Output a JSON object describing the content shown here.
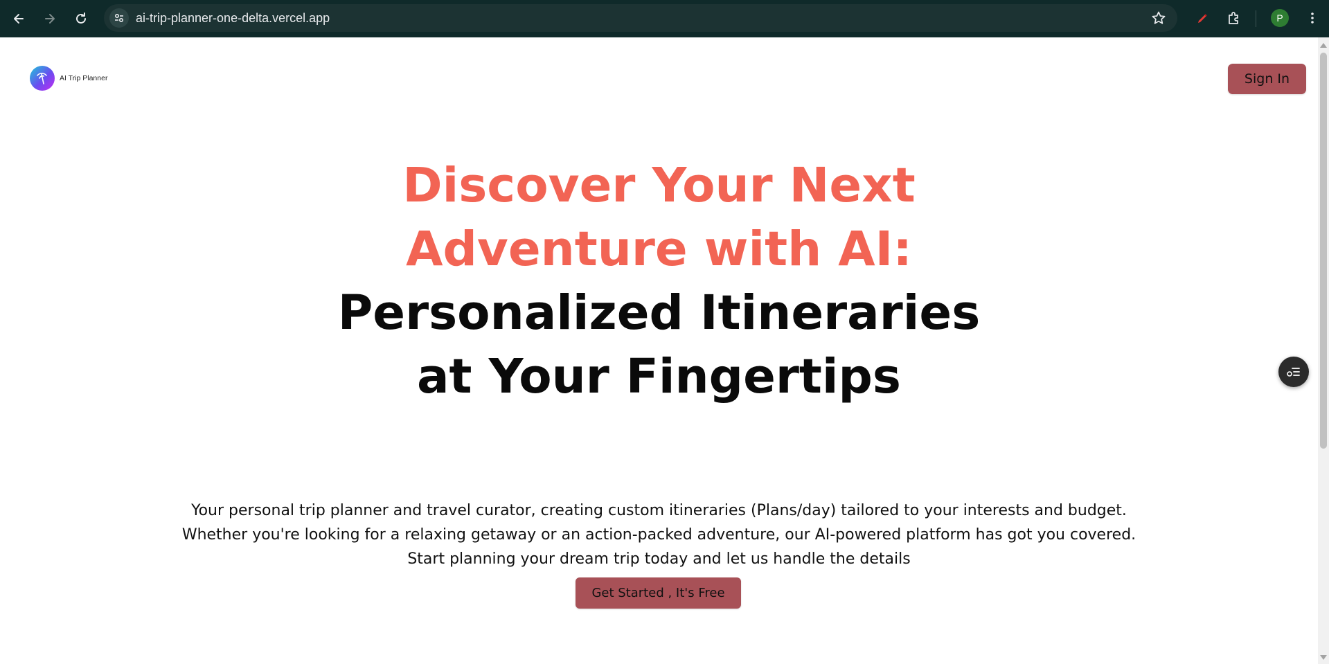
{
  "browser": {
    "url": "ai-trip-planner-one-delta.vercel.app",
    "profile_initial": "P"
  },
  "header": {
    "brand": "AI Trip Planner",
    "signin_label": "Sign In"
  },
  "hero": {
    "line1": "Discover Your Next",
    "line2": "Adventure with AI:",
    "line3": "Personalized Itineraries",
    "line4": "at Your Fingertips",
    "accent_color": "#f26454",
    "dark_color": "#0a0a0a"
  },
  "description": {
    "line1": "Your personal trip planner and travel curator, creating custom itineraries (Plans/day) tailored to your interests and budget.",
    "line2": "Whether you're looking for a relaxing getaway or an action-packed adventure, our AI-powered platform has got you covered.",
    "line3": "Start planning your dream trip today and let us handle the details"
  },
  "cta": {
    "label": "Get Started , It's Free"
  },
  "colors": {
    "button_bg": "#a85157",
    "chrome_bg": "#0f2a2a"
  }
}
